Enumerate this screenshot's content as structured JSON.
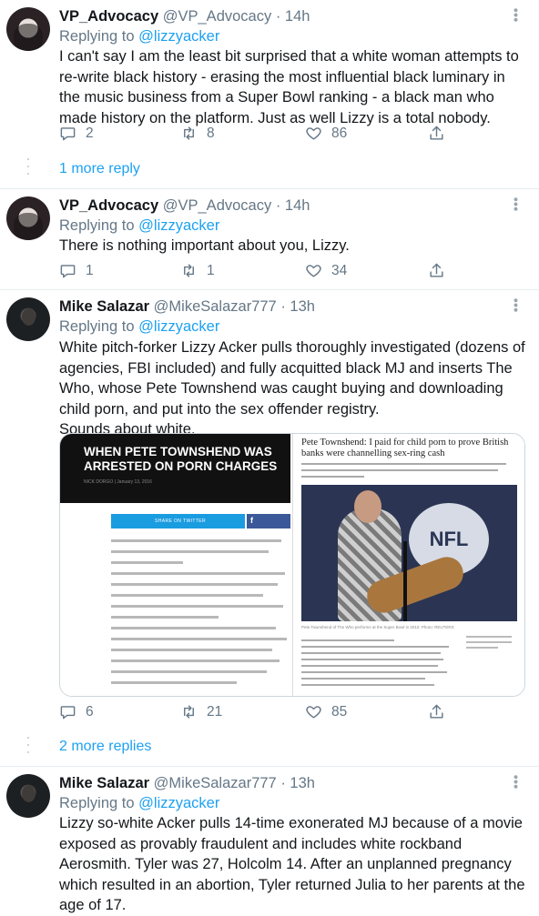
{
  "tweets": [
    {
      "name": "VP_Advocacy",
      "handle": "@VP_Advocacy",
      "dot": "·",
      "time": "14h",
      "replying_label": "Replying to",
      "replying_to": "@lizzyacker",
      "text": "I can't say I am the least bit surprised that a white woman attempts to re-write black history - erasing the most influential black luminary in the music business from a Super Bowl ranking - a black man who made history on the platform. Just as well Lizzy is a total nobody.",
      "replies": "2",
      "retweets": "8",
      "likes": "86",
      "more_replies": "1 more reply"
    },
    {
      "name": "VP_Advocacy",
      "handle": "@VP_Advocacy",
      "dot": "·",
      "time": "14h",
      "replying_label": "Replying to",
      "replying_to": "@lizzyacker",
      "text": "There is nothing important about you, Lizzy.",
      "replies": "1",
      "retweets": "1",
      "likes": "34"
    },
    {
      "name": "Mike Salazar",
      "handle": "@MikeSalazar777",
      "dot": "·",
      "time": "13h",
      "replying_label": "Replying to",
      "replying_to": "@lizzyacker",
      "text": "White pitch-forker Lizzy Acker pulls thoroughly investigated (dozens of agencies, FBI included) and fully acquitted black MJ and inserts The Who, whose Pete Townshend was caught buying and downloading child porn, and put into the sex offender registry.",
      "text2": "Sounds about white.",
      "media": {
        "left_headline": "WHEN PETE TOWNSHEND WAS ARRESTED ON PORN CHARGES",
        "left_byline": "NICK DORGO | January 13, 2016",
        "share_label": "SHARE ON TWITTER",
        "fb_label": "f",
        "right_headline": "Pete Townshend: I paid for child porn to prove British banks were channelling sex-ring cash",
        "nfl_logo": "NFL",
        "photo_caption": "Pete Townshend of The Who performs at the Super Bowl in 2010. Photo: REUTERS"
      },
      "replies": "6",
      "retweets": "21",
      "likes": "85",
      "more_replies": "2 more replies"
    },
    {
      "name": "Mike Salazar",
      "handle": "@MikeSalazar777",
      "dot": "·",
      "time": "13h",
      "replying_label": "Replying to",
      "replying_to": "@lizzyacker",
      "text": "Lizzy so-white Acker pulls 14-time exonerated MJ because of a movie exposed as provably fraudulent and includes white rockband Aerosmith. Tyler was 27, Holcolm 14. After an unplanned pregnancy which resulted in an abortion, Tyler returned Julia to her parents at the age of 17."
    }
  ],
  "icons": {
    "reply": "reply-icon",
    "retweet": "retweet-icon",
    "like": "heart-icon",
    "share": "share-icon",
    "more": "more-options-icon"
  },
  "colors": {
    "link": "#1da1f2",
    "muted": "#657786",
    "divider": "#e6ecf0"
  }
}
